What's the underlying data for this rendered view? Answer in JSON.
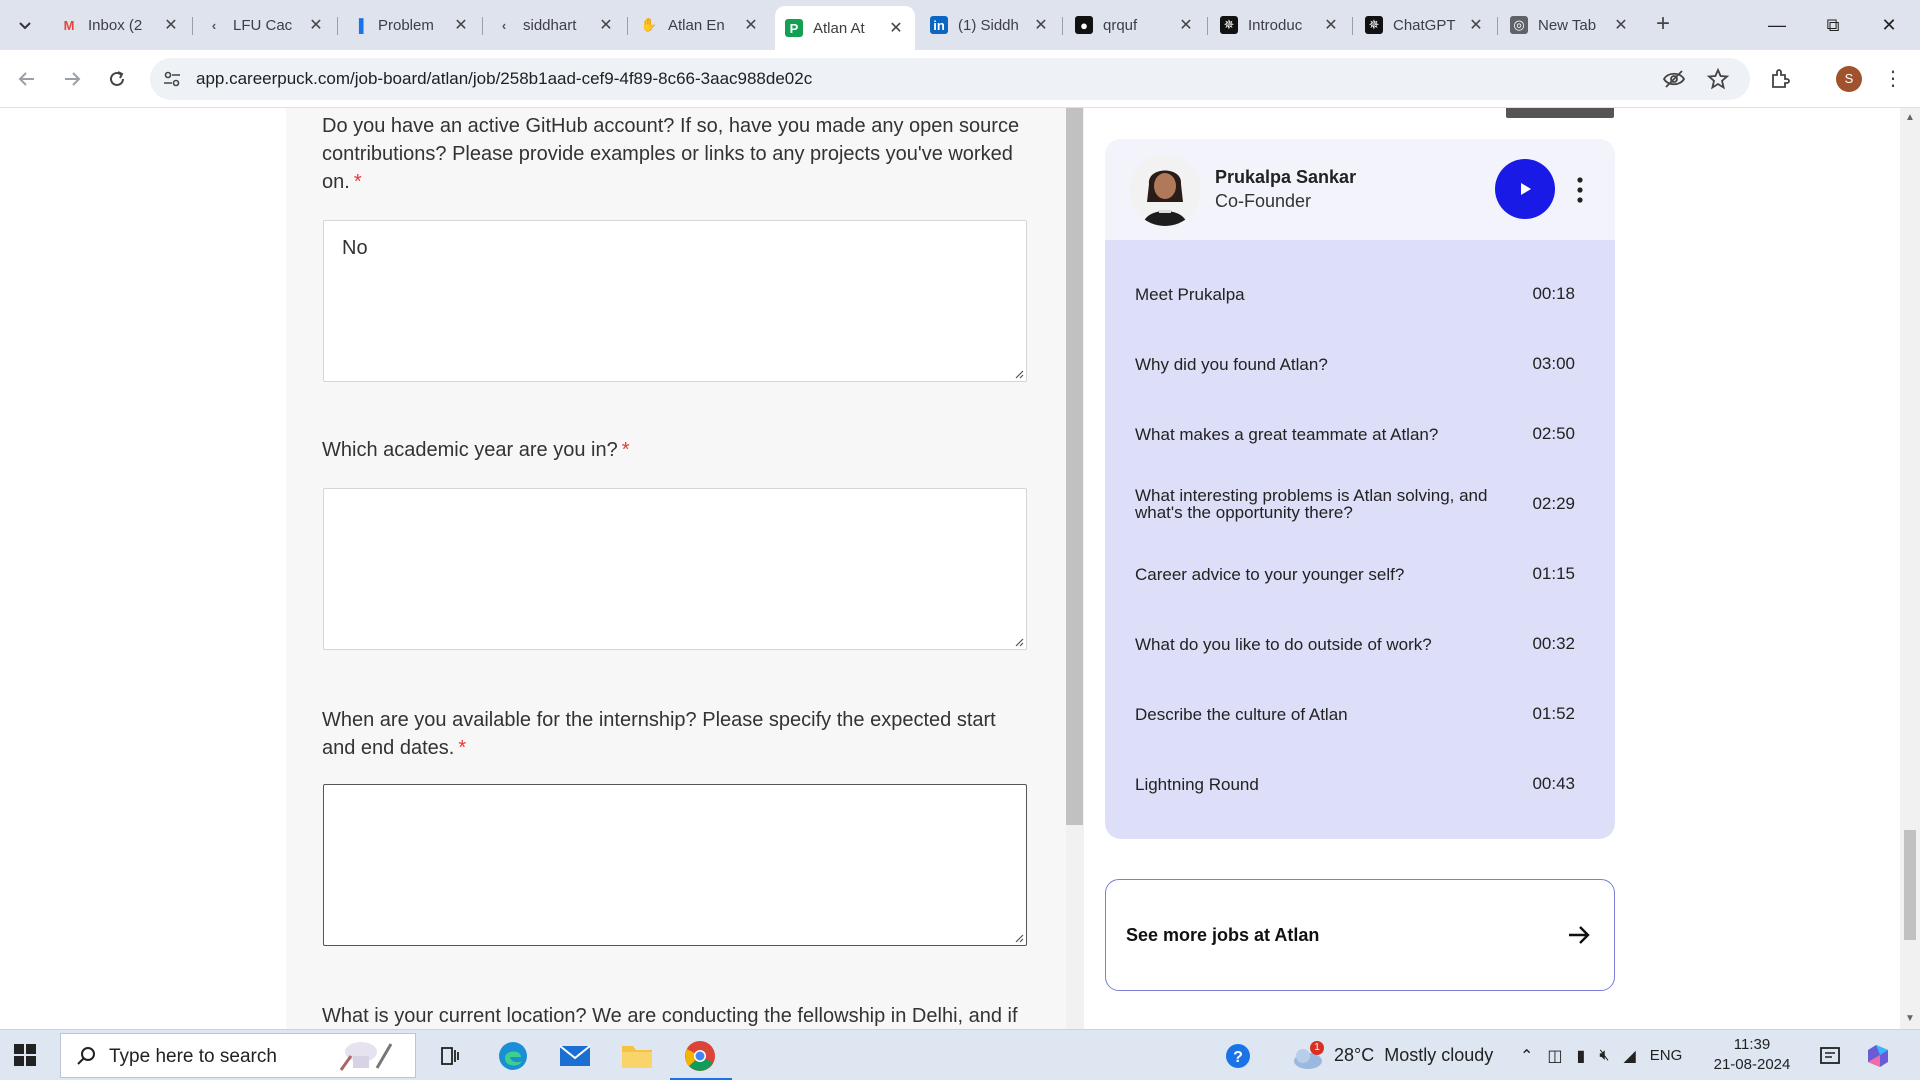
{
  "browser": {
    "tabs": [
      {
        "label": "Inbox (2",
        "icon": "gmail-icon",
        "active": false
      },
      {
        "label": "LFU Cac",
        "icon": "leetcode-icon",
        "active": false
      },
      {
        "label": "Problem",
        "icon": "chart-icon",
        "active": false
      },
      {
        "label": "siddhart",
        "icon": "leetcode-icon",
        "active": false
      },
      {
        "label": "Atlan En",
        "icon": "hands-icon",
        "active": false
      },
      {
        "label": "Atlan At",
        "icon": "careerpuck-icon",
        "active": true
      },
      {
        "label": "(1) Siddh",
        "icon": "linkedin-icon",
        "active": false
      },
      {
        "label": "qrquf",
        "icon": "github-icon",
        "active": false
      },
      {
        "label": "Introduc",
        "icon": "openai-icon",
        "active": false
      },
      {
        "label": "ChatGPT",
        "icon": "openai-icon",
        "active": false
      },
      {
        "label": "New Tab",
        "icon": "chrome-icon",
        "active": false
      }
    ],
    "url": "app.careerpuck.com/job-board/atlan/job/258b1aad-cef9-4f89-8c66-3aac988de02c",
    "profile_initial": "S"
  },
  "form": {
    "q1": {
      "text": "Do you have an active GitHub account? If so, have you made any open source contributions? Please provide examples or links to any projects you've worked on.",
      "required_mark": "*",
      "answer": "No"
    },
    "q2": {
      "text": "Which academic year are you in?",
      "required_mark": "*",
      "answer": ""
    },
    "q3": {
      "text": "When are you available for the internship? Please specify the expected start and end dates.",
      "required_mark": "*",
      "answer": ""
    },
    "q4": {
      "text": "What is your current location? We are conducting the fellowship in Delhi, and if"
    }
  },
  "video": {
    "name": "Prukalpa Sankar",
    "role": "Co-Founder",
    "chapters": [
      {
        "title": "Meet Prukalpa",
        "time": "00:18"
      },
      {
        "title": "Why did you found Atlan?",
        "time": "03:00"
      },
      {
        "title": "What makes a great teammate at Atlan?",
        "time": "02:50"
      },
      {
        "title": "What interesting problems is Atlan solving, and what's the opportunity there?",
        "time": "02:29"
      },
      {
        "title": "Career advice to your younger self?",
        "time": "01:15"
      },
      {
        "title": "What do you like to do outside of work?",
        "time": "00:32"
      },
      {
        "title": "Describe the culture of Atlan",
        "time": "01:52"
      },
      {
        "title": "Lightning Round",
        "time": "00:43"
      }
    ],
    "accent": "#1a1ae6"
  },
  "more_jobs": {
    "label": "See more jobs at Atlan"
  },
  "taskbar": {
    "search_placeholder": "Type here to search",
    "weather_temp": "28°C",
    "weather_text": "Mostly cloudy",
    "weather_badge": "1",
    "language": "ENG",
    "time": "11:39",
    "date": "21-08-2024"
  }
}
